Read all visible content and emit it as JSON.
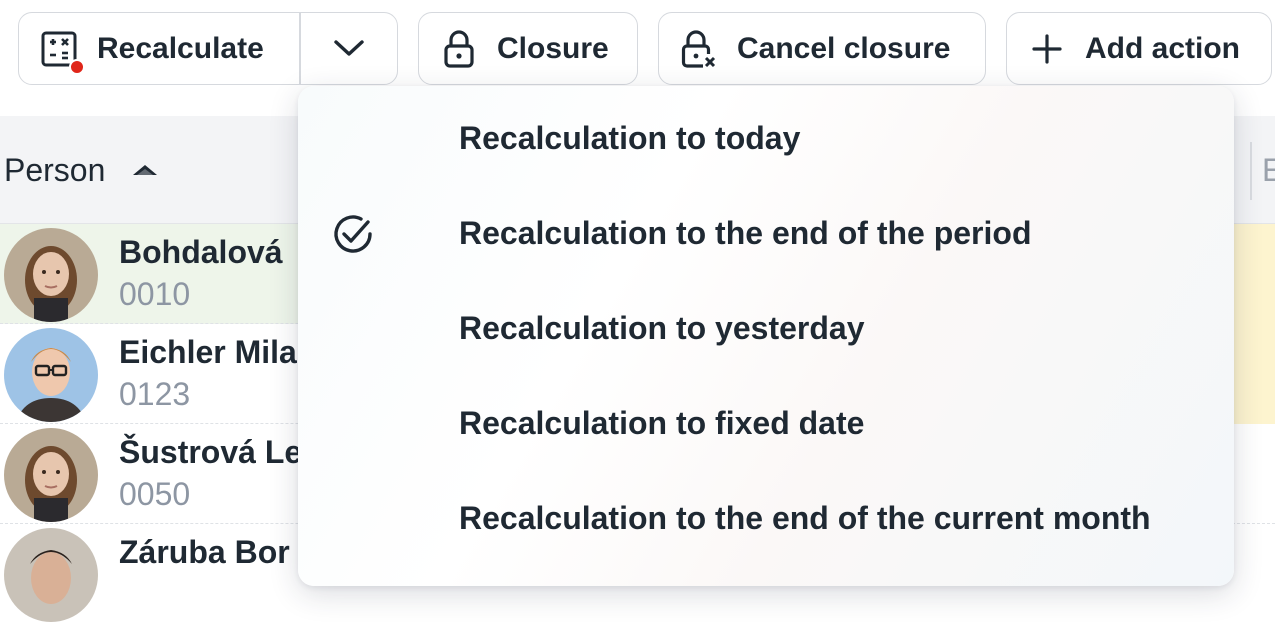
{
  "toolbar": {
    "recalculate_label": "Recalculate",
    "closure_label": "Closure",
    "cancel_closure_label": "Cancel closure",
    "add_action_label": "Add action"
  },
  "table": {
    "columns": {
      "person": "Person",
      "trailing": "E"
    },
    "rows": [
      {
        "name": "Bohdalová",
        "code": "0010"
      },
      {
        "name": "Eichler Mila",
        "code": "0123"
      },
      {
        "name": "Šustrová Le",
        "code": "0050"
      },
      {
        "name": "Záruba Bor",
        "code": ""
      }
    ]
  },
  "dropdown": {
    "items": [
      {
        "label": "Recalculation to today",
        "selected": false
      },
      {
        "label": "Recalculation to the end of the period",
        "selected": true
      },
      {
        "label": "Recalculation to yesterday",
        "selected": false
      },
      {
        "label": "Recalculation to fixed date",
        "selected": false
      },
      {
        "label": "Recalculation to the end of the current month",
        "selected": false
      }
    ]
  },
  "colors": {
    "status_dot": "#e0261a",
    "selected_row_bg": "#eef5ea",
    "highlight_cell_bg": "#fdf4cf",
    "secondary_text": "#8d96a3"
  },
  "icons": {
    "recalculate": "calculator-icon",
    "dropdown": "chevron-down-icon",
    "closure": "lock-icon",
    "cancel_closure": "lock-x-icon",
    "add_action": "plus-icon",
    "sort": "sort-ascending-icon",
    "selected": "check-circle-icon"
  }
}
